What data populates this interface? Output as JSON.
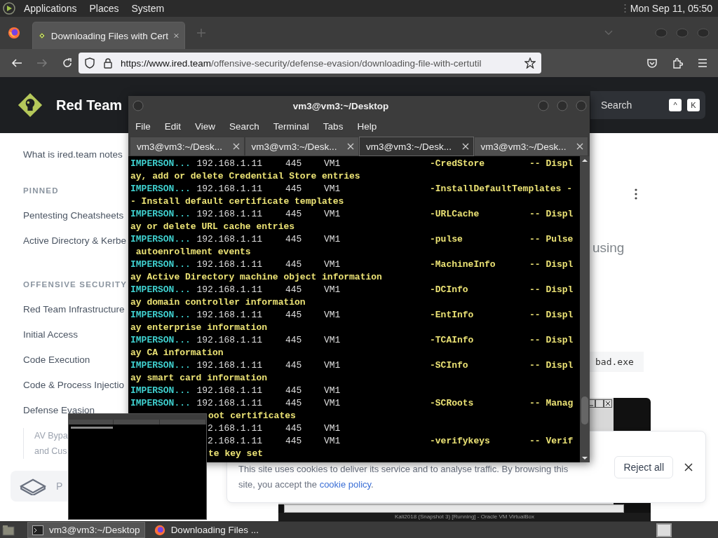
{
  "desktop_panel": {
    "menus": [
      "Applications",
      "Places",
      "System"
    ],
    "clock": "Mon Sep 11, 05:50"
  },
  "browser": {
    "tabs": [
      {
        "title": "Downloading Files with Cert",
        "selected": true
      }
    ],
    "forward_disabled": true,
    "url": {
      "host": "https://www.ired.team",
      "path": "/offensive-security/defense-evasion/downloading-file-with-certutil"
    }
  },
  "site": {
    "title": "Red Team",
    "search": {
      "placeholder": "Search",
      "keys": [
        "^",
        "K"
      ]
    },
    "sidebar": [
      {
        "kind": "link",
        "text": "What is ired.team notes"
      },
      {
        "kind": "section",
        "text": "PINNED"
      },
      {
        "kind": "link",
        "text": "Pentesting Cheatsheets"
      },
      {
        "kind": "link",
        "text": "Active Directory & Kerbe"
      },
      {
        "kind": "section",
        "text": "OFFENSIVE SECURITY"
      },
      {
        "kind": "link",
        "text": "Red Team Infrastructure"
      },
      {
        "kind": "link",
        "text": "Initial Access"
      },
      {
        "kind": "link",
        "text": "Code Execution"
      },
      {
        "kind": "link",
        "text": "Code & Process Injectio"
      },
      {
        "kind": "link",
        "text": "Defense Evasion"
      },
      {
        "kind": "sublink",
        "lines": [
          "AV Bypa",
          "and Cus"
        ]
      },
      {
        "kind": "card",
        "text": "P"
      }
    ],
    "heading_fragment": "using",
    "code": "bad.exe",
    "vm_caption": "Kali2018 (Snapshot 3) [Running] - Oracle VM VirtualBox"
  },
  "cookie_banner": {
    "line_1": "This site uses cookies to deliver its service and to analyse traffic. By browsing this",
    "line_2": "site, you accept the ",
    "link": "cookie policy",
    "end": ".",
    "button": "Reject all"
  },
  "terminal": {
    "title": "vm3@vm3:~/Desktop",
    "menus": [
      "File",
      "Edit",
      "View",
      "Search",
      "Terminal",
      "Tabs",
      "Help"
    ],
    "tabs": [
      {
        "label": "vm3@vm3:~/Desk...",
        "selected": false
      },
      {
        "label": "vm3@vm3:~/Desk...",
        "selected": false
      },
      {
        "label": "vm3@vm3:~/Desk...",
        "selected": true
      },
      {
        "label": "vm3@vm3:~/Desk...",
        "selected": false
      }
    ],
    "lines": [
      {
        "kind": "row",
        "host": "IMPERSON...",
        "ip": "192.168.1.11",
        "port": "445",
        "name": "VM1",
        "option": "-CredStore",
        "desc": "-- Displ"
      },
      {
        "kind": "wrap",
        "text": "ay, add or delete Credential Store entries",
        "covered": false
      },
      {
        "kind": "row",
        "host": "IMPERSON...",
        "ip": "192.168.1.11",
        "port": "445",
        "name": "VM1",
        "option": "-InstallDefaultTemplates",
        "desc": "-"
      },
      {
        "kind": "wrap",
        "text": "- Install default certificate templates",
        "covered": false
      },
      {
        "kind": "row",
        "host": "IMPERSON...",
        "ip": "192.168.1.11",
        "port": "445",
        "name": "VM1",
        "option": "-URLCache",
        "desc": "-- Displ"
      },
      {
        "kind": "wrap",
        "text": "ay or delete URL cache entries",
        "covered": false
      },
      {
        "kind": "row",
        "host": "IMPERSON...",
        "ip": "192.168.1.11",
        "port": "445",
        "name": "VM1",
        "option": "-pulse",
        "desc": "-- Pulse"
      },
      {
        "kind": "wrap",
        "text": " autoenrollment events",
        "covered": false
      },
      {
        "kind": "row",
        "host": "IMPERSON...",
        "ip": "192.168.1.11",
        "port": "445",
        "name": "VM1",
        "option": "-MachineInfo",
        "desc": "-- Displ"
      },
      {
        "kind": "wrap",
        "text": "ay Active Directory machine object information",
        "covered": false
      },
      {
        "kind": "row",
        "host": "IMPERSON...",
        "ip": "192.168.1.11",
        "port": "445",
        "name": "VM1",
        "option": "-DCInfo",
        "desc": "-- Displ"
      },
      {
        "kind": "wrap",
        "text": "ay domain controller information",
        "covered": false
      },
      {
        "kind": "row",
        "host": "IMPERSON...",
        "ip": "192.168.1.11",
        "port": "445",
        "name": "VM1",
        "option": "-EntInfo",
        "desc": "-- Displ"
      },
      {
        "kind": "wrap",
        "text": "ay enterprise information",
        "covered": false
      },
      {
        "kind": "row",
        "host": "IMPERSON...",
        "ip": "192.168.1.11",
        "port": "445",
        "name": "VM1",
        "option": "-TCAInfo",
        "desc": "-- Displ"
      },
      {
        "kind": "wrap",
        "text": "ay CA information",
        "covered": false
      },
      {
        "kind": "row",
        "host": "IMPERSON...",
        "ip": "192.168.1.11",
        "port": "445",
        "name": "VM1",
        "option": "-SCInfo",
        "desc": "-- Displ"
      },
      {
        "kind": "wrap",
        "text": "ay smart card information",
        "covered": false
      },
      {
        "kind": "row",
        "host": "IMPERSON...",
        "ip": "192.168.1.11",
        "port": "445",
        "name": "VM1"
      },
      {
        "kind": "row",
        "host": "IMPERSON...",
        "ip": "192.168.1.11",
        "port": "445",
        "name": "VM1",
        "option": "-SCRoots",
        "desc": "-- Manag"
      },
      {
        "kind": "wrap",
        "text": "oot certificates",
        "covered": true
      },
      {
        "kind": "row",
        "ip": "2.168.1.11",
        "port": "445",
        "name": "VM1"
      },
      {
        "kind": "row",
        "ip": "2.168.1.11",
        "port": "445",
        "name": "VM1",
        "option": "-verifykeys",
        "desc": "-- Verif"
      },
      {
        "kind": "wrap",
        "text": "te key set",
        "covered": true
      }
    ]
  },
  "taskbar": {
    "tasks": [
      {
        "kind": "terminal",
        "label": "vm3@vm3:~/Desktop",
        "selected": true
      },
      {
        "kind": "browser",
        "label": "Downloading Files ...",
        "selected": false
      }
    ]
  }
}
